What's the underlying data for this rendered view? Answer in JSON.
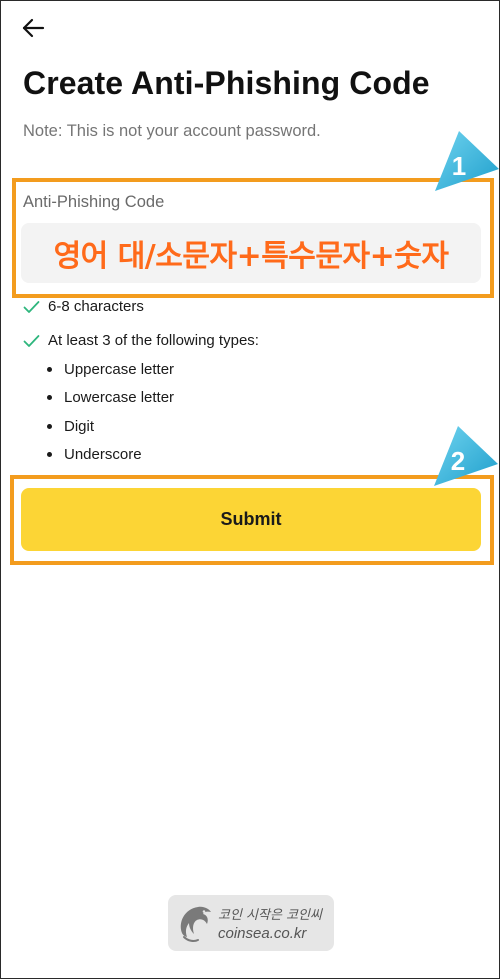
{
  "header": {
    "back_icon": "arrow-left-icon",
    "title": "Create Anti-Phishing Code",
    "note": "Note: This is not your account password."
  },
  "form": {
    "field_label": "Anti-Phishing Code",
    "field_value": "영어 대/소문자+특수문자+숫자",
    "requirements": [
      {
        "icon": "check-icon",
        "text": "6-8 characters"
      },
      {
        "icon": "check-icon",
        "text": "At least 3 of the following types:"
      }
    ],
    "types": [
      "Uppercase letter",
      "Lowercase letter",
      "Digit",
      "Underscore"
    ],
    "submit_label": "Submit"
  },
  "annotations": {
    "step_1": "1",
    "step_2": "2",
    "highlight_color": "#f39c1e",
    "marker_color": "#2fb8dc"
  },
  "watermark": {
    "slogan": "코인 시작은 코인씨",
    "domain": "coinsea.co.kr"
  },
  "colors": {
    "accent_button": "#fcd535",
    "input_text": "#ff6a1a",
    "check": "#2eb67d"
  }
}
